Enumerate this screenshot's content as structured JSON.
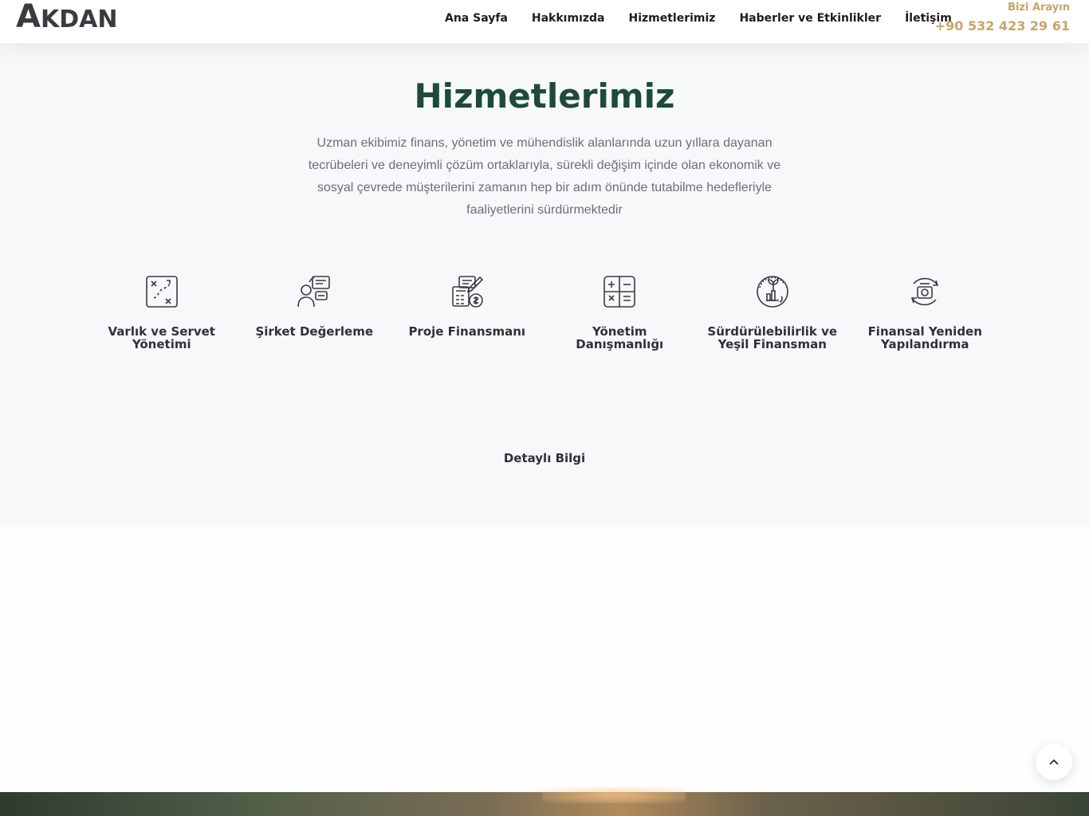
{
  "header": {
    "logo_first": "A",
    "logo_rest": "KDAN",
    "nav": [
      "Ana Sayfa",
      "Hakkımızda",
      "Hizmetlerimiz",
      "Haberler ve Etkinlikler",
      "İletişim"
    ],
    "call_label": "Bizi Arayın",
    "call_phone": "+90 532 423 29 61"
  },
  "services": {
    "title": "Hizmetlerimiz",
    "description": "Uzman ekibimiz finans, yönetim ve mühendislik alanlarında uzun yıllara dayanan tecrübeleri ve deneyimli çözüm ortaklarıyla, sürekli değişim içinde olan ekonomik ve sosyal çevrede müşterilerini zamanın hep bir adım önünde tutabilme hedefleriyle faaliyetlerini sürdürmektedir",
    "items": [
      {
        "label": "Varlık ve Servet Yönetimi",
        "icon": "strategy-icon"
      },
      {
        "label": "Şirket Değerleme",
        "icon": "consultant-icon"
      },
      {
        "label": "Proje Finansmanı",
        "icon": "calculator-pen-icon"
      },
      {
        "label": "Yönetim Danışmanlığı",
        "icon": "math-operations-icon"
      },
      {
        "label": "Sürdürülebilirlik ve Yeşil Finansman",
        "icon": "green-growth-icon"
      },
      {
        "label": "Finansal Yeniden Yapılandırma",
        "icon": "money-cycle-icon"
      }
    ],
    "more_label": "Detaylı Bilgi"
  },
  "back_to_top_icon": "chevron-up-icon",
  "colors": {
    "title": "#1d4a3c",
    "accent": "#c8a36a"
  }
}
